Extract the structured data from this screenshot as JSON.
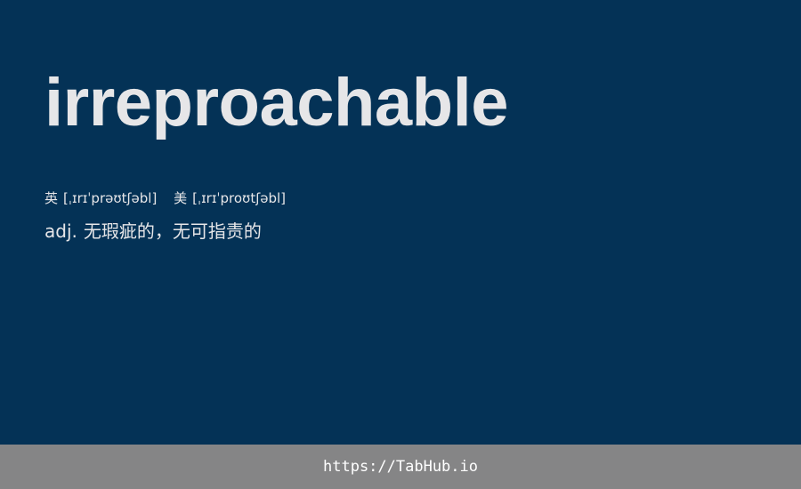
{
  "entry": {
    "word": "irreproachable",
    "pronunciations": [
      {
        "region": "英",
        "ipa": "[ˌɪrɪˈprəʊtʃəbl]"
      },
      {
        "region": "美",
        "ipa": "[ˌɪrɪˈproʊtʃəbl]"
      }
    ],
    "definition": {
      "part_of_speech": "adj.",
      "meaning": "无瑕疵的，无可指责的"
    }
  },
  "footer": {
    "link_text": "https://TabHub.io"
  },
  "colors": {
    "background": "#043256",
    "text": "#e6e6e8",
    "footer_background": "#858586",
    "footer_text": "#ffffff"
  }
}
